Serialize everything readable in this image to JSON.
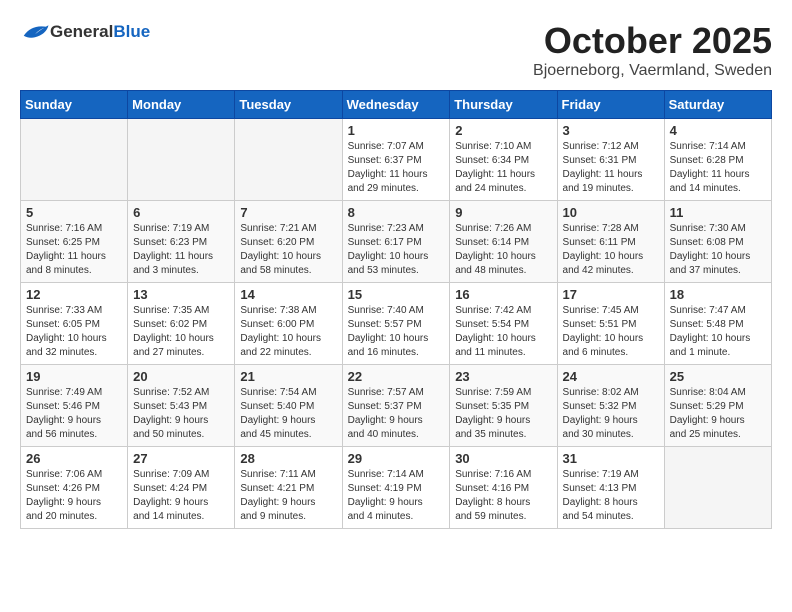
{
  "header": {
    "logo_general": "General",
    "logo_blue": "Blue",
    "month": "October 2025",
    "location": "Bjoerneborg, Vaermland, Sweden"
  },
  "days_of_week": [
    "Sunday",
    "Monday",
    "Tuesday",
    "Wednesday",
    "Thursday",
    "Friday",
    "Saturday"
  ],
  "weeks": [
    [
      {
        "day": "",
        "info": ""
      },
      {
        "day": "",
        "info": ""
      },
      {
        "day": "",
        "info": ""
      },
      {
        "day": "1",
        "info": "Sunrise: 7:07 AM\nSunset: 6:37 PM\nDaylight: 11 hours\nand 29 minutes."
      },
      {
        "day": "2",
        "info": "Sunrise: 7:10 AM\nSunset: 6:34 PM\nDaylight: 11 hours\nand 24 minutes."
      },
      {
        "day": "3",
        "info": "Sunrise: 7:12 AM\nSunset: 6:31 PM\nDaylight: 11 hours\nand 19 minutes."
      },
      {
        "day": "4",
        "info": "Sunrise: 7:14 AM\nSunset: 6:28 PM\nDaylight: 11 hours\nand 14 minutes."
      }
    ],
    [
      {
        "day": "5",
        "info": "Sunrise: 7:16 AM\nSunset: 6:25 PM\nDaylight: 11 hours\nand 8 minutes."
      },
      {
        "day": "6",
        "info": "Sunrise: 7:19 AM\nSunset: 6:23 PM\nDaylight: 11 hours\nand 3 minutes."
      },
      {
        "day": "7",
        "info": "Sunrise: 7:21 AM\nSunset: 6:20 PM\nDaylight: 10 hours\nand 58 minutes."
      },
      {
        "day": "8",
        "info": "Sunrise: 7:23 AM\nSunset: 6:17 PM\nDaylight: 10 hours\nand 53 minutes."
      },
      {
        "day": "9",
        "info": "Sunrise: 7:26 AM\nSunset: 6:14 PM\nDaylight: 10 hours\nand 48 minutes."
      },
      {
        "day": "10",
        "info": "Sunrise: 7:28 AM\nSunset: 6:11 PM\nDaylight: 10 hours\nand 42 minutes."
      },
      {
        "day": "11",
        "info": "Sunrise: 7:30 AM\nSunset: 6:08 PM\nDaylight: 10 hours\nand 37 minutes."
      }
    ],
    [
      {
        "day": "12",
        "info": "Sunrise: 7:33 AM\nSunset: 6:05 PM\nDaylight: 10 hours\nand 32 minutes."
      },
      {
        "day": "13",
        "info": "Sunrise: 7:35 AM\nSunset: 6:02 PM\nDaylight: 10 hours\nand 27 minutes."
      },
      {
        "day": "14",
        "info": "Sunrise: 7:38 AM\nSunset: 6:00 PM\nDaylight: 10 hours\nand 22 minutes."
      },
      {
        "day": "15",
        "info": "Sunrise: 7:40 AM\nSunset: 5:57 PM\nDaylight: 10 hours\nand 16 minutes."
      },
      {
        "day": "16",
        "info": "Sunrise: 7:42 AM\nSunset: 5:54 PM\nDaylight: 10 hours\nand 11 minutes."
      },
      {
        "day": "17",
        "info": "Sunrise: 7:45 AM\nSunset: 5:51 PM\nDaylight: 10 hours\nand 6 minutes."
      },
      {
        "day": "18",
        "info": "Sunrise: 7:47 AM\nSunset: 5:48 PM\nDaylight: 10 hours\nand 1 minute."
      }
    ],
    [
      {
        "day": "19",
        "info": "Sunrise: 7:49 AM\nSunset: 5:46 PM\nDaylight: 9 hours\nand 56 minutes."
      },
      {
        "day": "20",
        "info": "Sunrise: 7:52 AM\nSunset: 5:43 PM\nDaylight: 9 hours\nand 50 minutes."
      },
      {
        "day": "21",
        "info": "Sunrise: 7:54 AM\nSunset: 5:40 PM\nDaylight: 9 hours\nand 45 minutes."
      },
      {
        "day": "22",
        "info": "Sunrise: 7:57 AM\nSunset: 5:37 PM\nDaylight: 9 hours\nand 40 minutes."
      },
      {
        "day": "23",
        "info": "Sunrise: 7:59 AM\nSunset: 5:35 PM\nDaylight: 9 hours\nand 35 minutes."
      },
      {
        "day": "24",
        "info": "Sunrise: 8:02 AM\nSunset: 5:32 PM\nDaylight: 9 hours\nand 30 minutes."
      },
      {
        "day": "25",
        "info": "Sunrise: 8:04 AM\nSunset: 5:29 PM\nDaylight: 9 hours\nand 25 minutes."
      }
    ],
    [
      {
        "day": "26",
        "info": "Sunrise: 7:06 AM\nSunset: 4:26 PM\nDaylight: 9 hours\nand 20 minutes."
      },
      {
        "day": "27",
        "info": "Sunrise: 7:09 AM\nSunset: 4:24 PM\nDaylight: 9 hours\nand 14 minutes."
      },
      {
        "day": "28",
        "info": "Sunrise: 7:11 AM\nSunset: 4:21 PM\nDaylight: 9 hours\nand 9 minutes."
      },
      {
        "day": "29",
        "info": "Sunrise: 7:14 AM\nSunset: 4:19 PM\nDaylight: 9 hours\nand 4 minutes."
      },
      {
        "day": "30",
        "info": "Sunrise: 7:16 AM\nSunset: 4:16 PM\nDaylight: 8 hours\nand 59 minutes."
      },
      {
        "day": "31",
        "info": "Sunrise: 7:19 AM\nSunset: 4:13 PM\nDaylight: 8 hours\nand 54 minutes."
      },
      {
        "day": "",
        "info": ""
      }
    ]
  ]
}
